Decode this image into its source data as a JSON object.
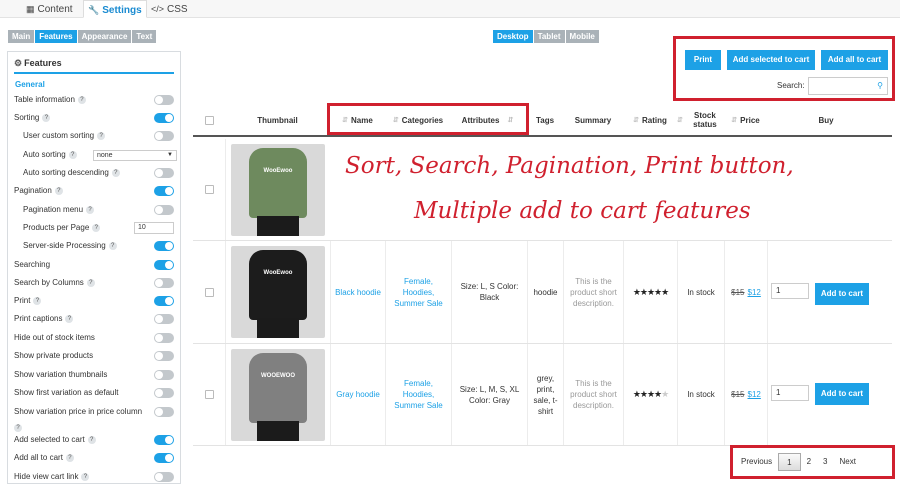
{
  "top_tabs": [
    {
      "label": "Content",
      "icon": "grid-icon"
    },
    {
      "label": "Settings",
      "icon": "wrench-icon"
    },
    {
      "label": "CSS",
      "icon": "code-icon"
    }
  ],
  "sub_tabs": [
    "Main",
    "Features",
    "Appearance",
    "Text"
  ],
  "device_tabs": [
    "Desktop",
    "Tablet",
    "Mobile"
  ],
  "panel": {
    "title": "Features",
    "section": "General",
    "rows": [
      {
        "label": "Table information",
        "toggle": false
      },
      {
        "label": "Sorting",
        "toggle": true
      },
      {
        "label": "User custom sorting",
        "toggle": false
      },
      {
        "label": "Auto sorting",
        "select": "none"
      },
      {
        "label": "Auto sorting descending",
        "toggle": false
      },
      {
        "label": "Pagination",
        "toggle": true
      },
      {
        "label": "Pagination menu",
        "toggle": false
      },
      {
        "label": "Products per Page",
        "value": "10"
      },
      {
        "label": "Server-side Processing",
        "toggle": true
      },
      {
        "label": "Searching",
        "toggle": true
      },
      {
        "label": "Search by Columns",
        "toggle": false
      },
      {
        "label": "Print",
        "toggle": true
      },
      {
        "label": "Print captions",
        "toggle": false
      },
      {
        "label": "Hide out of stock items",
        "toggle": false
      },
      {
        "label": "Show private products",
        "toggle": false
      },
      {
        "label": "Show variation thumbnails",
        "toggle": false
      },
      {
        "label": "Show first variation as default",
        "toggle": false
      },
      {
        "label": "Show variation price in price column",
        "toggle": false
      },
      {
        "label": "Add selected to cart",
        "toggle": true
      },
      {
        "label": "Add all to cart",
        "toggle": true
      },
      {
        "label": "Hide view cart link",
        "toggle": false
      }
    ]
  },
  "toolbar": {
    "print": "Print",
    "add_selected": "Add selected to cart",
    "add_all": "Add all to cart",
    "search_label": "Search:"
  },
  "table": {
    "headers": [
      "Thumbnail",
      "Name",
      "Categories",
      "Attributes",
      "Tags",
      "Summary",
      "Rating",
      "Stock status",
      "Price",
      "Buy"
    ],
    "rows": [
      {
        "name": "",
        "categories": "",
        "attributes": "",
        "tags": "",
        "summary": "",
        "rating": 0,
        "stock": "",
        "price_old": "",
        "price_new": "",
        "qty": "",
        "buy": "",
        "color": "#6e8a5e",
        "brand": "WooEwoo"
      },
      {
        "name": "Black hoodie",
        "categories": "Female, Hoodies, Summer Sale",
        "attributes": "Size: L, S Color: Black",
        "tags": "hoodie",
        "summary": "This is the product short description.",
        "rating": 5,
        "stock": "In stock",
        "price_old": "$15",
        "price_new": "$12",
        "qty": "1",
        "buy": "Add to cart",
        "color": "#1c1c1c",
        "brand": "WooEwoo"
      },
      {
        "name": "Gray hoodie",
        "categories": "Female, Hoodies, Summer Sale",
        "attributes": "Size: L, M, S, XL Color: Gray",
        "tags": "grey, print, sale, t-shirt",
        "summary": "This is the product short description.",
        "rating": 4,
        "stock": "In stock",
        "price_old": "$15",
        "price_new": "$12",
        "qty": "1",
        "buy": "Add to cart",
        "color": "#808080",
        "brand": "WOOEWOO"
      }
    ]
  },
  "overlay": {
    "line1": "Sort, Search, Pagination, Print button,",
    "line2": "Multiple add to cart features"
  },
  "pagination": {
    "previous": "Previous",
    "pages": [
      "1",
      "2",
      "3"
    ],
    "current": "1",
    "next": "Next"
  },
  "colors": {
    "accent": "#1da1e6",
    "highlight": "#d0202e"
  }
}
